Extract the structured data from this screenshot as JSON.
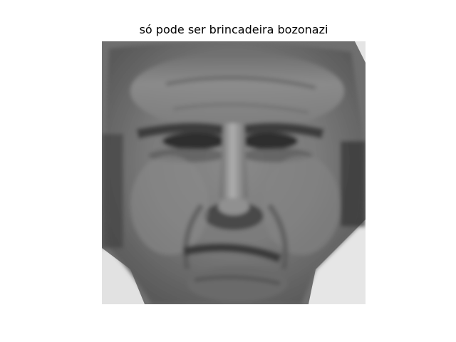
{
  "figure": {
    "title": "só pode ser brincadeira bozonazi"
  },
  "image": {
    "description_icon": "grayscale-face-photo",
    "palette": {
      "background": "#ffffff",
      "skin_mid": "#7c7c7c",
      "skin_light": "#9a9a9a",
      "skin_dark": "#4a4a4a",
      "shadow": "#2e2e2e",
      "corner_light": "#e4e4e4"
    }
  }
}
